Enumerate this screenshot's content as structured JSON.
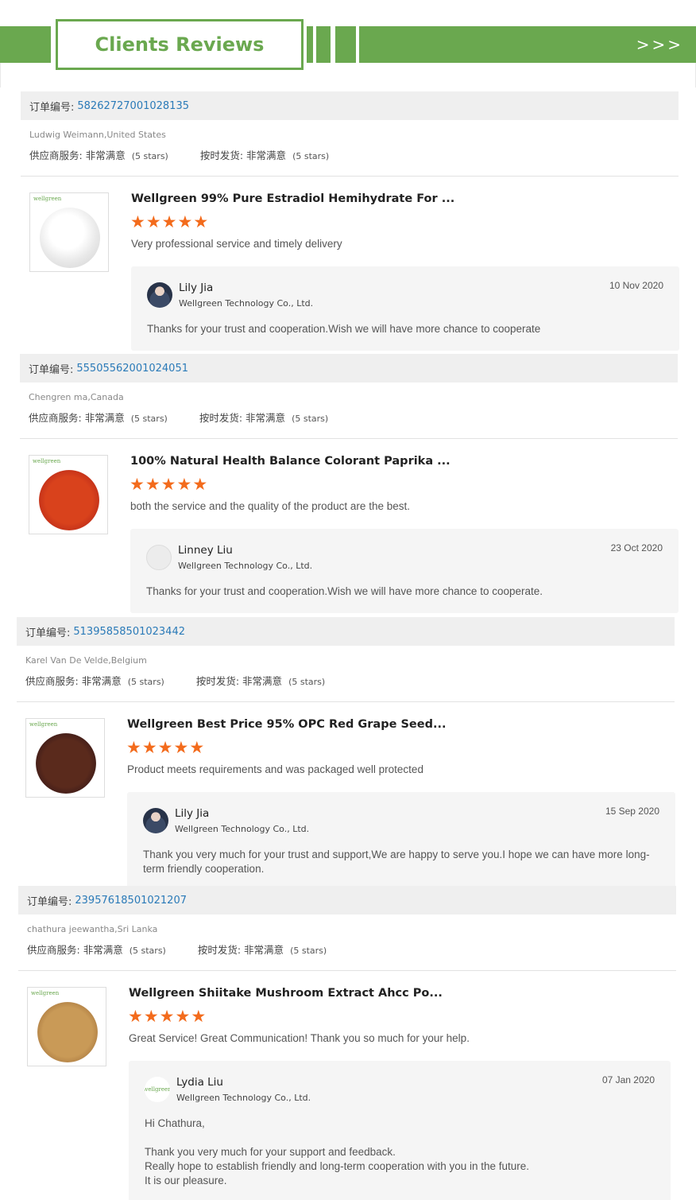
{
  "header": {
    "title": "Clients Reviews",
    "arrows": ">>>"
  },
  "reviews": [
    {
      "order_label": "订单编号:",
      "order_number": "58262727001028135",
      "buyer": "Ludwig Weimann,United States",
      "supplier_service_label": "供应商服务:",
      "supplier_service_value": "非常满意",
      "supplier_service_stars": "(5 stars)",
      "delivery_label": "按时发货:",
      "delivery_value": "非常满意",
      "delivery_stars": "(5 stars)",
      "product_title": "Wellgreen 99% Pure Estradiol Hemihydrate For ...",
      "rating": 5,
      "comment": "Very professional service and timely delivery",
      "reply": {
        "name": "Lily Jia",
        "company": "Wellgreen Technology Co., Ltd.",
        "date": "10 Nov 2020",
        "text": "Thanks for your trust and cooperation.Wish we will have more chance to cooperate"
      }
    },
    {
      "order_label": "订单编号:",
      "order_number": "55505562001024051",
      "buyer": "Chengren ma,Canada",
      "supplier_service_label": "供应商服务:",
      "supplier_service_value": "非常满意",
      "supplier_service_stars": "(5 stars)",
      "delivery_label": "按时发货:",
      "delivery_value": "非常满意",
      "delivery_stars": "(5 stars)",
      "product_title": "100% Natural Health Balance Colorant Paprika ...",
      "rating": 5,
      "comment": "both the service and the quality of the product are the best.",
      "reply": {
        "name": "Linney Liu",
        "company": "Wellgreen Technology Co., Ltd.",
        "date": "23 Oct 2020",
        "text": "Thanks for your trust and cooperation.Wish we will have more chance to cooperate."
      }
    },
    {
      "order_label": "订单编号:",
      "order_number": "51395858501023442",
      "buyer": "Karel Van De Velde,Belgium",
      "supplier_service_label": "供应商服务:",
      "supplier_service_value": "非常满意",
      "supplier_service_stars": "(5 stars)",
      "delivery_label": "按时发货:",
      "delivery_value": "非常满意",
      "delivery_stars": "(5 stars)",
      "product_title": "Wellgreen Best Price 95% OPC Red Grape Seed...",
      "rating": 5,
      "comment": "Product meets requirements and was packaged well protected",
      "reply": {
        "name": "Lily Jia",
        "company": "Wellgreen Technology Co., Ltd.",
        "date": "15 Sep 2020",
        "text": "Thank you very much for your trust and support,We are happy to serve you.I hope we can have more long-\nterm friendly cooperation."
      }
    },
    {
      "order_label": "订单编号:",
      "order_number": "23957618501021207",
      "buyer": "chathura jeewantha,Sri Lanka",
      "supplier_service_label": "供应商服务:",
      "supplier_service_value": "非常满意",
      "supplier_service_stars": "(5 stars)",
      "delivery_label": "按时发货:",
      "delivery_value": "非常满意",
      "delivery_stars": "(5 stars)",
      "product_title": "Wellgreen Shiitake Mushroom Extract Ahcc Po...",
      "rating": 5,
      "comment": "Great Service! Great Communication! Thank you so much for your help.",
      "reply": {
        "name": "Lydia Liu",
        "company": "Wellgreen Technology Co., Ltd.",
        "date": "07 Jan 2020",
        "text": "Hi Chathura,\n\nThank you very much for your support and feedback.\nReally hope to establish friendly and long-term cooperation with you in the future.\nIt is our pleasure."
      }
    }
  ],
  "brand_mark": "wellgreen",
  "colors": {
    "accent_green": "#6aa84f",
    "star_orange": "#f36b1c",
    "order_link_blue": "#2a7ab8",
    "panel_gray": "#efefef"
  }
}
